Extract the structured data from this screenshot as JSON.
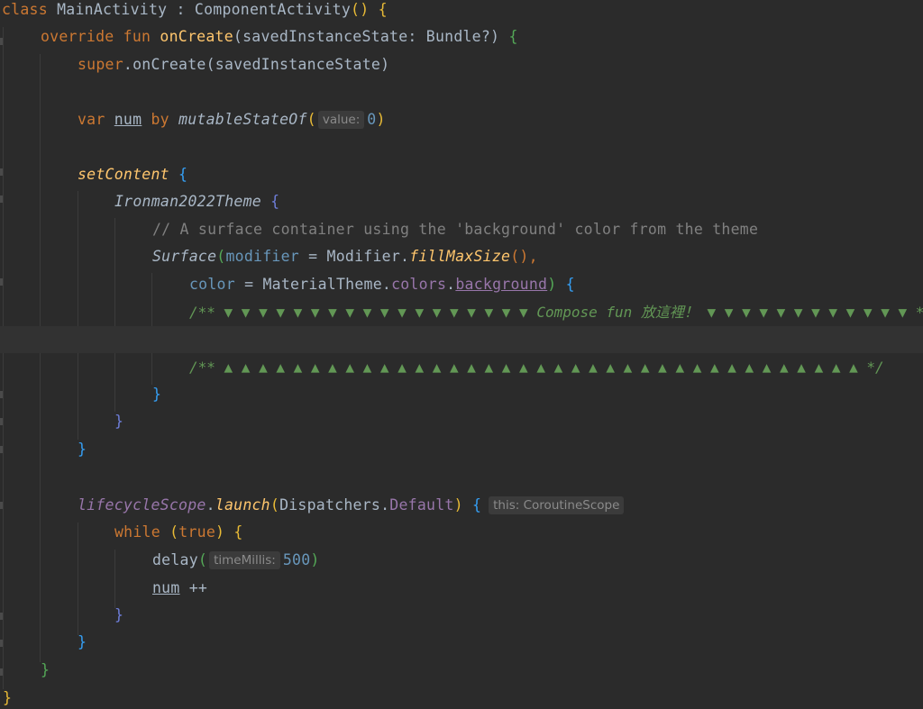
{
  "code": {
    "class_keyword": "class",
    "class_name": "MainActivity",
    "class_colon": " : ",
    "class_super": "ComponentActivity",
    "class_super_parens": "()",
    "brace_open": "{",
    "brace_close": "}",
    "override_keyword": "override",
    "fun_keyword": "fun",
    "on_create": "onCreate",
    "on_create_params": "(savedInstanceState: Bundle?)",
    "super_keyword": "super",
    "super_call": ".onCreate(savedInstanceState)",
    "var_keyword": "var",
    "var_name": "num",
    "by_keyword": "by",
    "mutable_state_of": "mutableStateOf",
    "paren_open": "(",
    "paren_close": ")",
    "hint_value": "value:",
    "init_value": "0",
    "set_content": "setContent",
    "theme_name": "Ironman2022Theme",
    "comment_surface": "// A surface container using the 'background' color from the theme",
    "surface": "Surface",
    "modifier_param": "modifier",
    "equals": " = ",
    "modifier_obj": "Modifier.",
    "fill_max_size": "fillMaxSize",
    "parens_comma": "(),",
    "color_param": "color",
    "material_theme": "MaterialTheme.",
    "colors_prop": "colors",
    "dot": ".",
    "background_prop": "background",
    "todo_start": "/** ▼ ▼ ▼ ▼ ▼ ▼ ▼ ▼ ▼ ▼ ▼ ▼ ▼ ▼ ▼ ▼ ▼ ▼ Compose fun 放這裡！ ▼ ▼ ▼ ▼ ▼ ▼ ▼ ▼ ▼ ▼ ▼ ▼ */",
    "todo_end": "/** ▲ ▲ ▲ ▲ ▲ ▲ ▲ ▲ ▲ ▲ ▲ ▲ ▲ ▲ ▲ ▲ ▲ ▲ ▲ ▲ ▲ ▲ ▲ ▲ ▲ ▲ ▲ ▲ ▲ ▲ ▲ ▲ ▲ ▲ ▲ ▲ ▲ */",
    "lifecycle_scope": "lifecycleScope",
    "launch": "launch",
    "dispatchers": "Dispatchers.",
    "default_prop": "Default",
    "hint_this": "this: CoroutineScope",
    "while_keyword": "while",
    "true_keyword": "true",
    "delay": "delay",
    "hint_time": "timeMillis:",
    "delay_value": "500",
    "increment": " ++"
  },
  "theme": {
    "background": "#2b2b2b",
    "keyword": "#cc7832",
    "function": "#ffc66d",
    "number": "#6897bb",
    "property": "#9876aa",
    "comment": "#808080",
    "todo_comment": "#629755",
    "text": "#a9b7c6"
  }
}
